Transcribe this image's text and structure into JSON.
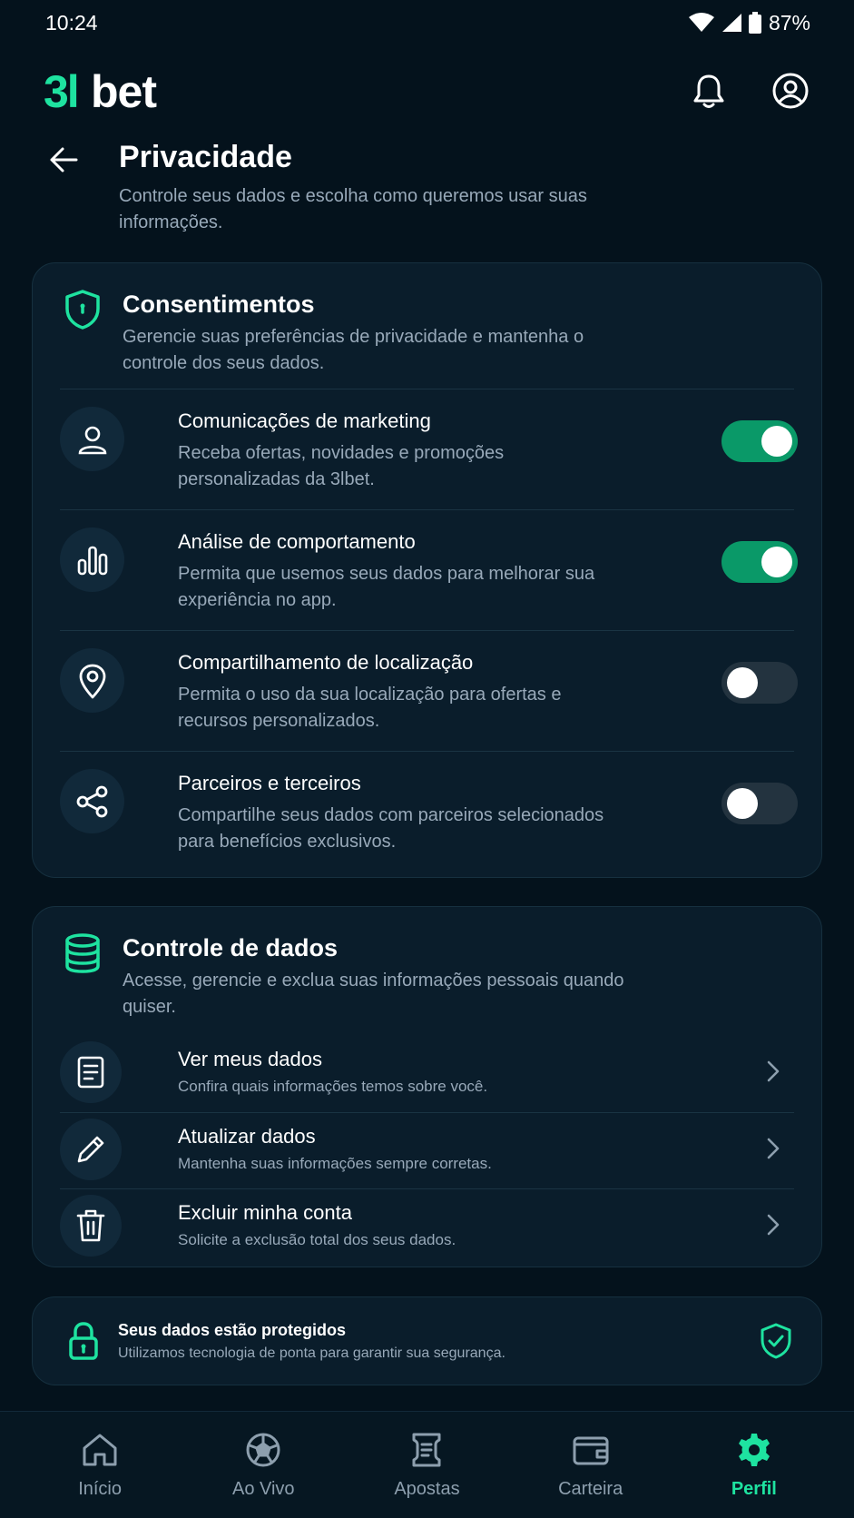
{
  "status_bar": {
    "time": "10:24",
    "battery": "87%"
  },
  "brand": {
    "logo_text": "3lbet",
    "accent": "#1ee3a0",
    "toggle_on": "#0a9968"
  },
  "header": {
    "notification_icon": "bell-icon",
    "profile_icon": "user-circle-icon"
  },
  "page": {
    "title": "Privacidade",
    "subtitle": "Controle seus dados e escolha como queremos usar suas informações."
  },
  "consent": {
    "title": "Consentimentos",
    "description": "Gerencie suas preferências de privacidade e mantenha o controle dos seus dados.",
    "items": [
      {
        "icon": "user-icon",
        "title": "Comunicações de marketing",
        "description": "Receba ofertas, novidades e promoções personalizadas da 3lbet.",
        "enabled": true
      },
      {
        "icon": "bar-chart-icon",
        "title": "Análise de comportamento",
        "description": "Permita que usemos seus dados para melhorar sua experiência no app.",
        "enabled": true
      },
      {
        "icon": "location-pin-icon",
        "title": "Compartilhamento de localização",
        "description": "Permita o uso da sua localização para ofertas e recursos personalizados.",
        "enabled": false
      },
      {
        "icon": "share-icon",
        "title": "Parceiros e terceiros",
        "description": "Compartilhe seus dados com parceiros selecionados para benefícios exclusivos.",
        "enabled": false
      }
    ]
  },
  "data_control": {
    "title": "Controle de dados",
    "description": "Acesse, gerencie e exclua suas informações pessoais quando quiser.",
    "items": [
      {
        "icon": "document-icon",
        "title": "Ver meus dados",
        "description": "Confira quais informações temos sobre você."
      },
      {
        "icon": "pencil-icon",
        "title": "Atualizar dados",
        "description": "Mantenha suas informações sempre corretas."
      },
      {
        "icon": "trash-icon",
        "title": "Excluir minha conta",
        "description": "Solicite a exclusão total dos seus dados."
      }
    ]
  },
  "security_notice": {
    "title": "Seus dados estão protegidos",
    "description": "Utilizamos tecnologia de ponta para garantir sua segurança."
  },
  "bottom_nav": {
    "items": [
      {
        "icon": "home-icon",
        "label": "Início",
        "active": false
      },
      {
        "icon": "soccer-ball-icon",
        "label": "Ao Vivo",
        "active": false
      },
      {
        "icon": "ticket-icon",
        "label": "Apostas",
        "active": false
      },
      {
        "icon": "wallet-icon",
        "label": "Carteira",
        "active": false
      },
      {
        "icon": "gear-icon",
        "label": "Perfil",
        "active": true
      }
    ]
  }
}
